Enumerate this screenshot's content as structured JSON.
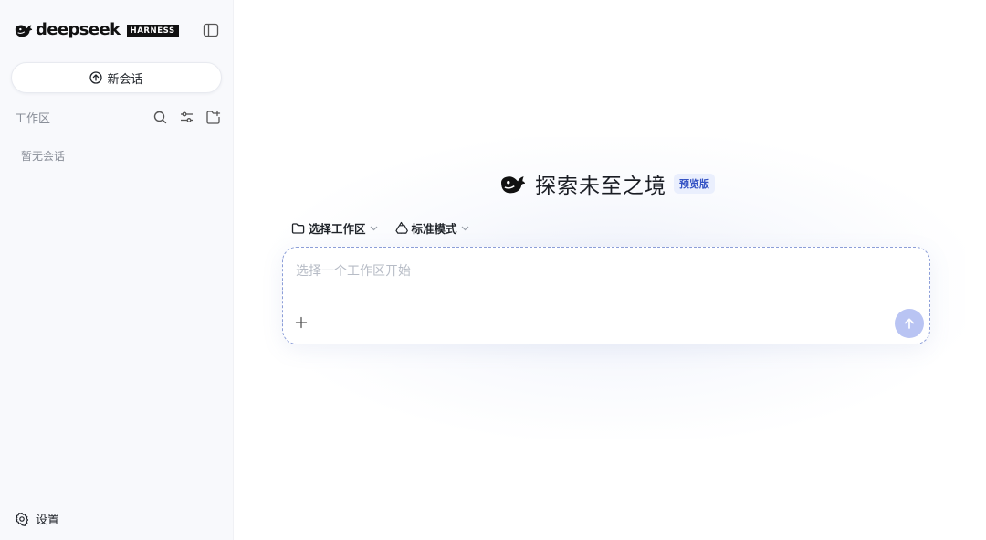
{
  "sidebar": {
    "brand": {
      "wordmark": "deepseek",
      "badge": "HARNESS",
      "icon": "whale-logo-icon"
    },
    "new_chat_label": "新会话",
    "workspace_label": "工作区",
    "empty_text": "暂无会话",
    "settings_label": "设置"
  },
  "main": {
    "hero_title": "探索未至之境",
    "hero_badge": "预览版",
    "toolbar": {
      "workspace_select": "选择工作区",
      "mode_select": "标准模式"
    },
    "composer": {
      "placeholder": "选择一个工作区开始"
    }
  },
  "colors": {
    "accent": "#3553c4",
    "badge_bg": "#eaeffd",
    "send_button": "#b9c4f3",
    "composer_border": "#8c9ed8",
    "sidebar_bg": "#f8f9fc"
  }
}
